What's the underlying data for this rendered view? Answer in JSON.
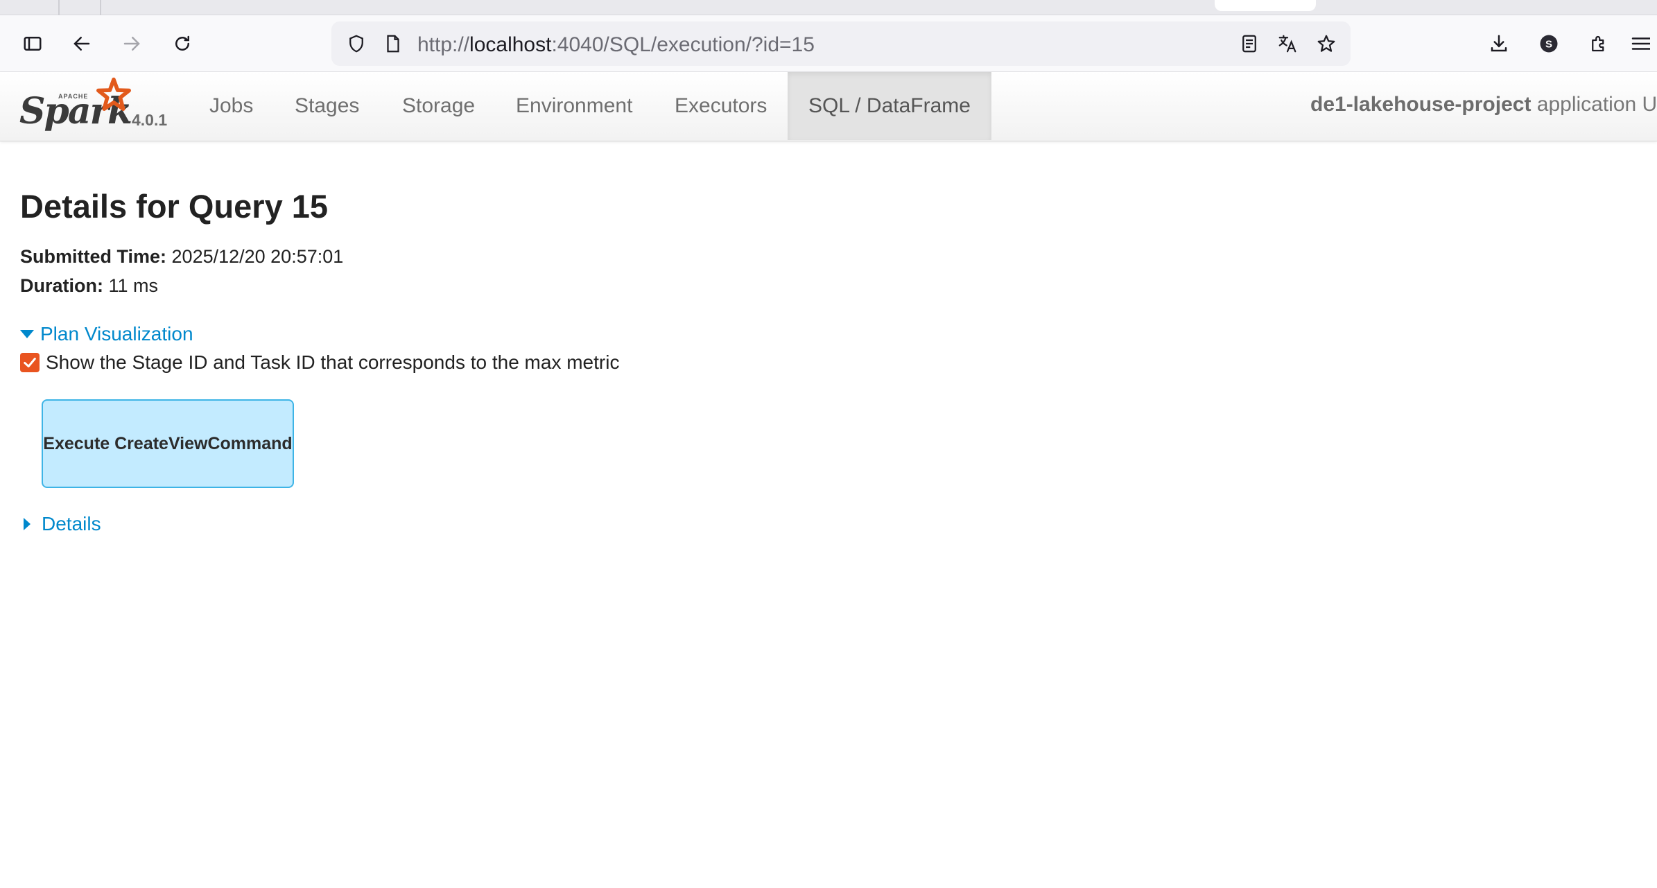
{
  "browser": {
    "url_prefix": "http://",
    "url_host": "localhost",
    "url_rest": ":4040/SQL/execution/?id=15",
    "account_initial": "S"
  },
  "spark": {
    "logo_word": "Spark",
    "logo_apache": "APACHE",
    "version": "4.0.1",
    "tabs": [
      {
        "label": "Jobs",
        "active": false
      },
      {
        "label": "Stages",
        "active": false
      },
      {
        "label": "Storage",
        "active": false
      },
      {
        "label": "Environment",
        "active": false
      },
      {
        "label": "Executors",
        "active": false
      },
      {
        "label": "SQL / DataFrame",
        "active": true
      }
    ],
    "app_name": "de1-lakehouse-project",
    "app_suffix": " application U"
  },
  "page": {
    "title": "Details for Query 15",
    "submitted_label": "Submitted Time:",
    "submitted_value": " 2025/12/20 20:57:01",
    "duration_label": "Duration:",
    "duration_value": " 11 ms",
    "plan_visualization": "Plan Visualization",
    "show_stage_label": "Show the Stage ID and Task ID that corresponds to the max metric",
    "show_stage_checked": true,
    "plan_node": "Execute CreateViewCommand",
    "details": "Details"
  },
  "colors": {
    "accent_link": "#0088cc",
    "checkbox": "#e95420",
    "node_fill": "#c3ebff",
    "node_border": "#3eb4e6"
  }
}
